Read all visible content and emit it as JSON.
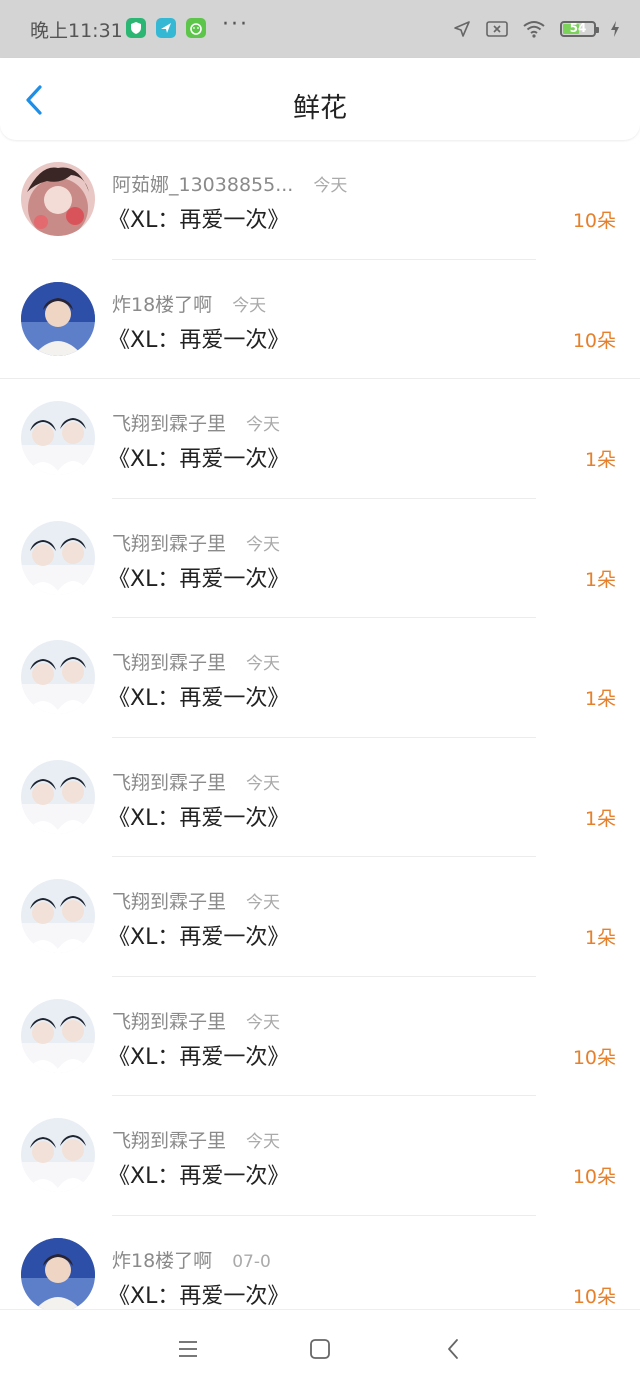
{
  "status_bar": {
    "time": "晚上11:31",
    "battery_percent": "54",
    "battery_level": 0.54,
    "colors": {
      "notif1": "#2bb673",
      "notif2": "#35b8d4",
      "notif3": "#5cc54a",
      "battery": "#7bd35a"
    },
    "icons": [
      "shield-app-icon",
      "send-app-icon",
      "android-app-icon",
      "more-dots-icon",
      "location-arrow-icon",
      "no-sim-icon",
      "wifi-icon",
      "battery-icon",
      "charging-bolt-icon"
    ]
  },
  "header": {
    "title": "鲜花",
    "back_icon": "back-chevron-icon"
  },
  "records": [
    {
      "user": "阿茹娜_13038855...",
      "date": "今天",
      "work": "《XL：再爱一次》",
      "amount": "10朵",
      "avatar": "pink"
    },
    {
      "user": "炸18楼了啊",
      "date": "今天",
      "work": "《XL：再爱一次》",
      "amount": "10朵",
      "avatar": "blue"
    },
    {
      "user": "飞翔到霖子里",
      "date": "今天",
      "work": "《XL：再爱一次》",
      "amount": "1朵",
      "avatar": "pale"
    },
    {
      "user": "飞翔到霖子里",
      "date": "今天",
      "work": "《XL：再爱一次》",
      "amount": "1朵",
      "avatar": "pale"
    },
    {
      "user": "飞翔到霖子里",
      "date": "今天",
      "work": "《XL：再爱一次》",
      "amount": "1朵",
      "avatar": "pale"
    },
    {
      "user": "飞翔到霖子里",
      "date": "今天",
      "work": "《XL：再爱一次》",
      "amount": "1朵",
      "avatar": "pale"
    },
    {
      "user": "飞翔到霖子里",
      "date": "今天",
      "work": "《XL：再爱一次》",
      "amount": "1朵",
      "avatar": "pale"
    },
    {
      "user": "飞翔到霖子里",
      "date": "今天",
      "work": "《XL：再爱一次》",
      "amount": "10朵",
      "avatar": "pale"
    },
    {
      "user": "飞翔到霖子里",
      "date": "今天",
      "work": "《XL：再爱一次》",
      "amount": "10朵",
      "avatar": "pale"
    },
    {
      "user": "炸18楼了啊",
      "date": "07-0",
      "work": "《XL：再爱一次》",
      "amount": "10朵",
      "avatar": "blue"
    }
  ],
  "colors": {
    "amount": "#e6802c",
    "username": "#8a8a8a",
    "date": "#aaaaaa",
    "accent": "#1e8ee6"
  },
  "navbar": {
    "icons": [
      "menu-icon",
      "home-square-icon",
      "back-triangle-icon"
    ]
  }
}
